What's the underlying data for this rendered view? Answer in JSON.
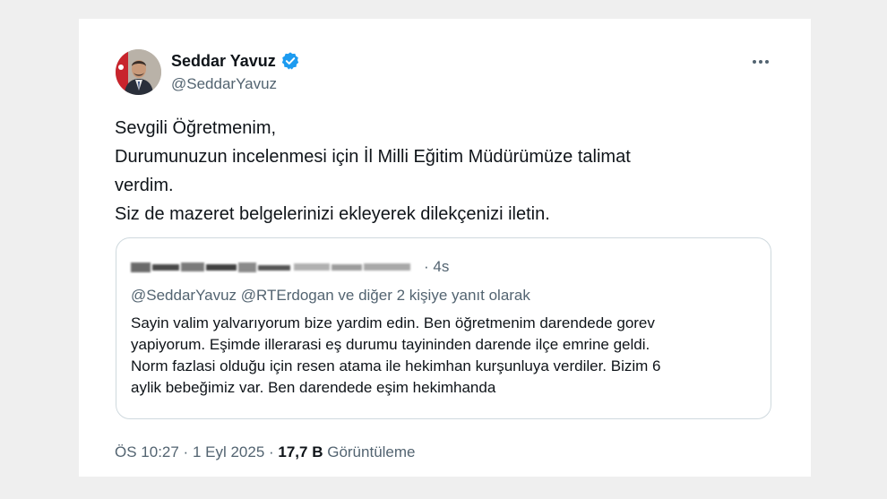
{
  "author": {
    "display_name": "Seddar Yavuz",
    "handle": "@SeddarYavuz",
    "verified": true,
    "accent_color": "#1d9bf0"
  },
  "more_icon": "more-horizontal-icon",
  "tweet": {
    "lines": [
      "Sevgili Öğretmenim,",
      "Durumunuzun incelenmesi için İl Milli Eğitim Müdürümüze talimat",
      "verdim.",
      "Siz de mazeret belgelerinizi ekleyerek dilekçenizi iletin."
    ]
  },
  "quoted": {
    "time": "· 4s",
    "reply_mentions": "@SeddarYavuz @RTErdogan",
    "reply_suffix": " ve diğer 2 kişiye yanıt olarak",
    "lines": [
      "Sayin valim yalvarıyorum bize yardim edin. Ben öğretmenim darendede gorev",
      "yapiyorum. Eşimde illerarasi eş durumu tayininden darende ilçe emrine geldi.",
      "Norm fazlasi olduğu için resen atama ile hekimhan kurşunluya verdiler. Bizim 6",
      "aylik bebeğimiz var. Ben darendede eşim hekimhanda"
    ]
  },
  "meta": {
    "time": "ÖS 10:27",
    "date": "1 Eyl 2025",
    "views_count": "17,7 B",
    "views_label": "Görüntüleme"
  }
}
